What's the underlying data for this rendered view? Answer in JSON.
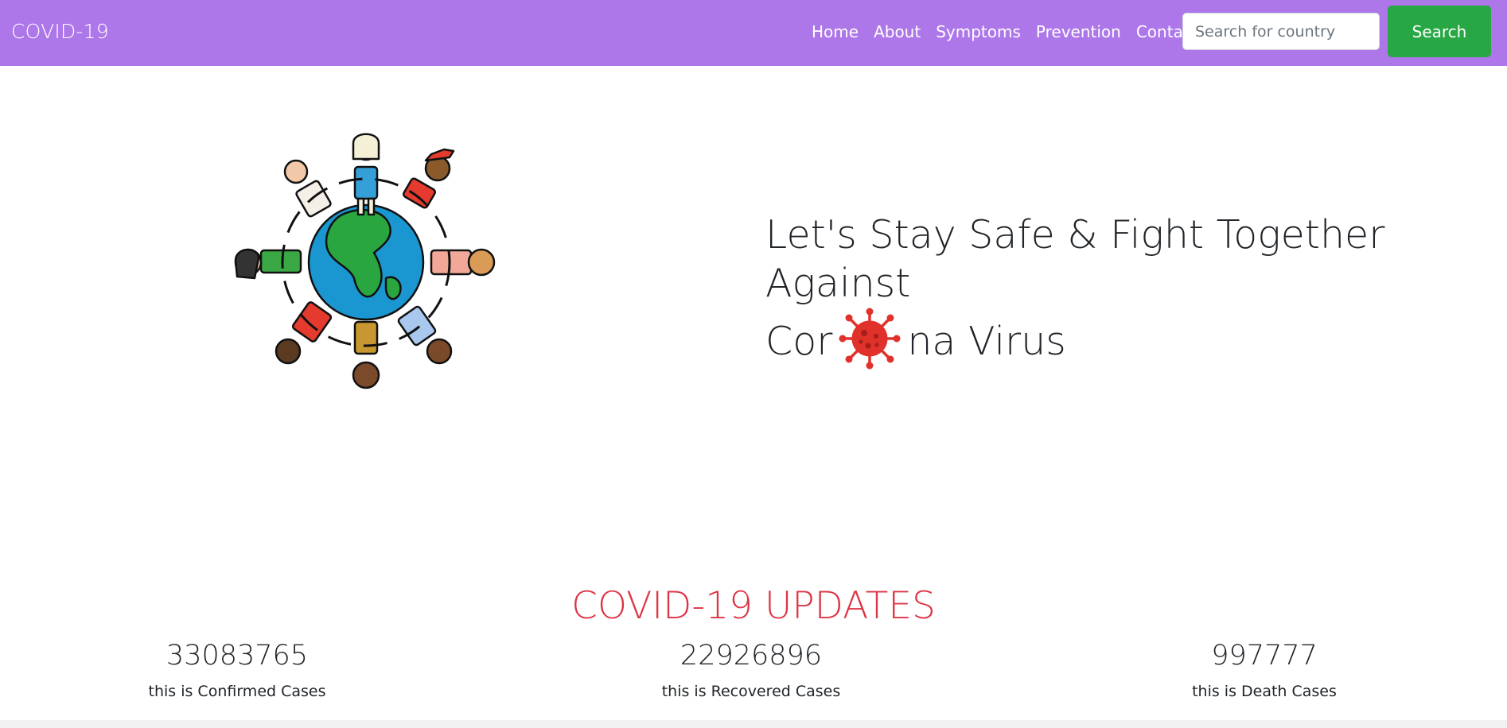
{
  "navbar": {
    "brand": "COVID-19",
    "links": [
      "Home",
      "About",
      "Symptoms",
      "Prevention",
      "Contact"
    ],
    "search_placeholder": "Search for country",
    "search_button": "Search",
    "background_color": "#ad77e9",
    "button_color": "#28a745"
  },
  "hero": {
    "headline_part1": "Let's Stay Safe & Fight Together Against",
    "headline_part2a": "Cor",
    "headline_part2b": "na Virus",
    "art_icon": "children-around-globe-illustration",
    "inline_icon": "coronavirus-icon"
  },
  "updates": {
    "title": "COVID-19 UPDATES",
    "title_color": "#dc3545",
    "stats": [
      {
        "value": "33083765",
        "label": "this is Confirmed Cases"
      },
      {
        "value": "22926896",
        "label": "this is Recovered Cases"
      },
      {
        "value": "997777",
        "label": "this is Death Cases"
      }
    ]
  }
}
